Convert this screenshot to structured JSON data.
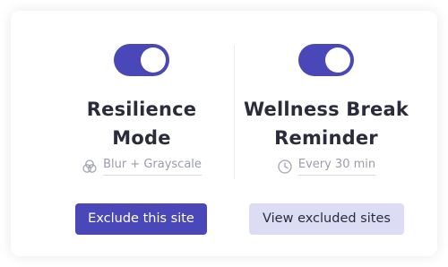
{
  "left_feature": {
    "toggle_on": true,
    "title_line1": "Resilience",
    "title_line2": "Mode",
    "subtitle": "Blur + Grayscale",
    "subtitle_icon": "blend-circles-icon"
  },
  "right_feature": {
    "toggle_on": true,
    "title_line1": "Wellness Break",
    "title_line2": "Reminder",
    "subtitle": "Every 30 min",
    "subtitle_icon": "clock-icon"
  },
  "buttons": {
    "exclude_label": "Exclude this site",
    "view_excluded_label": "View excluded sites"
  },
  "colors": {
    "accent": "#4a48b8",
    "secondary_button_bg": "#dcdcf5",
    "title_text": "#2a2c3c",
    "muted_text": "#9a9cac"
  }
}
